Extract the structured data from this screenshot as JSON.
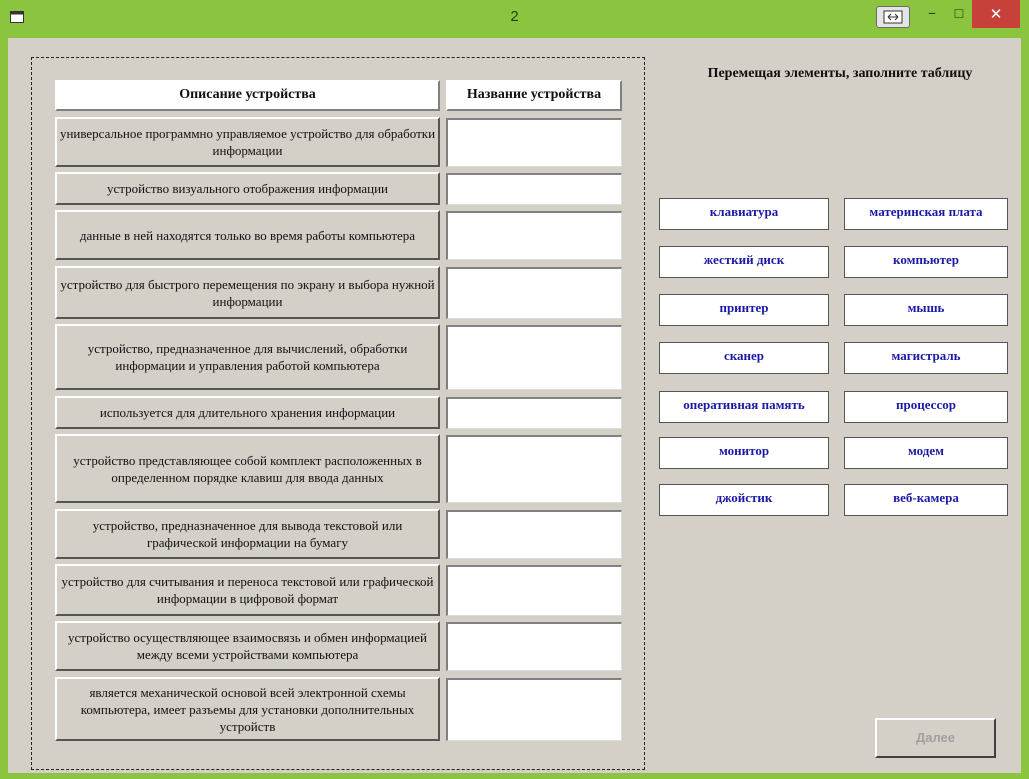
{
  "window": {
    "title": "2"
  },
  "table": {
    "header_description": "Описание устройства",
    "header_name": "Название устройства",
    "rows": [
      {
        "description": "универсальное программно управляемое устройство для обработки информации",
        "answer": ""
      },
      {
        "description": "устройство визуального отображения информации",
        "answer": ""
      },
      {
        "description": "данные в ней находятся только во время работы компьютера",
        "answer": ""
      },
      {
        "description": "устройство для быстрого перемещения по экрану и выбора нужной информации",
        "answer": ""
      },
      {
        "description": "устройство, предназначенное для вычислений, обработки информации и управления работой компьютера",
        "answer": ""
      },
      {
        "description": "используется для длительного хранения информации",
        "answer": ""
      },
      {
        "description": "устройство представляющее собой комплект расположенных в определенном порядке клавиш для ввода данных",
        "answer": ""
      },
      {
        "description": "устройство, предназначенное для вывода текстовой или графической информации на бумагу",
        "answer": ""
      },
      {
        "description": "устройство для считывания и переноса текстовой или графической информации в цифровой формат",
        "answer": ""
      },
      {
        "description": "устройство осуществляющее взаимосвязь и обмен информацией между всеми устройствами компьютера",
        "answer": ""
      },
      {
        "description": "является механической основой всей электронной схемы компьютера, имеет разъемы для установки дополнительных устройств",
        "answer": ""
      }
    ]
  },
  "instruction": "Перемещая элементы, заполните таблицу",
  "chips": [
    "клавиатура",
    "материнская плата",
    "жесткий диск",
    "компьютер",
    "принтер",
    "мышь",
    "сканер",
    "магистраль",
    "оперативная память",
    "процессор",
    "монитор",
    "модем",
    "джойстик",
    "веб-камера"
  ],
  "next_button": "Далее",
  "colors": {
    "frame": "#8bc53f",
    "client": "#d4d0c8",
    "chip_text": "#1a1aa6",
    "close_button": "#c7403a"
  },
  "icons": {
    "app": "window-icon",
    "restore": "restore-icon",
    "minimize": "minimize-icon",
    "maximize": "maximize-icon",
    "close": "close-icon"
  }
}
